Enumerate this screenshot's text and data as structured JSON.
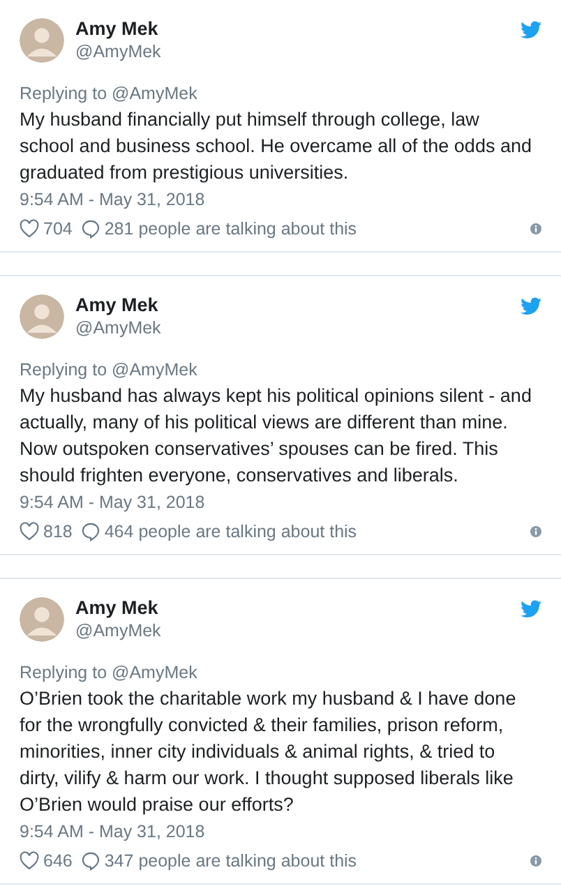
{
  "tweets": [
    {
      "name": "Amy Mek",
      "handle": "@AmyMek",
      "replying": "Replying to @AmyMek",
      "text": "My husband financially put himself through college, law school and business school. He overcame all of the odds and graduated from prestigious universities.",
      "time": "9:54 AM - May 31, 2018",
      "likes": "704",
      "talking": "281 people are talking about this"
    },
    {
      "name": "Amy Mek",
      "handle": "@AmyMek",
      "replying": "Replying to @AmyMek",
      "text": "My husband has always kept his political opinions silent - and actually, many of his political views are different than mine. Now outspoken conservatives’ spouses can be fired. This should frighten everyone, conservatives and liberals.",
      "time": "9:54 AM - May 31, 2018",
      "likes": "818",
      "talking": "464 people are talking about this"
    },
    {
      "name": "Amy Mek",
      "handle": "@AmyMek",
      "replying": "Replying to @AmyMek",
      "text": "O’Brien took the charitable work my husband & I have done for the wrongfully convicted & their families, prison reform, minorities, inner city individuals & animal rights, & tried to dirty, vilify & harm our work. I thought supposed liberals like O’Brien would praise our efforts?",
      "time": "9:54 AM - May 31, 2018",
      "likes": "646",
      "talking": "347 people are talking about this"
    }
  ]
}
